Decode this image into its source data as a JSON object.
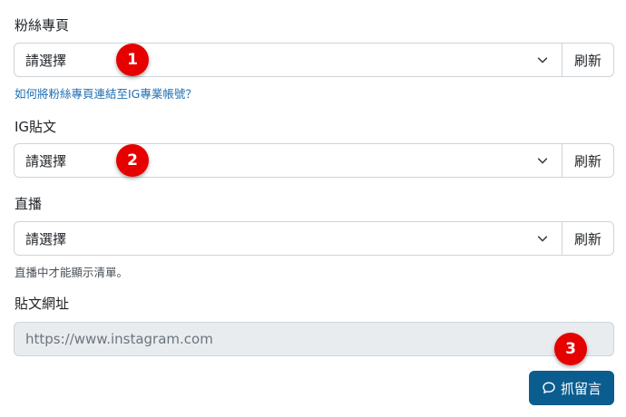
{
  "fan_page": {
    "label": "粉絲專頁",
    "select_value": "請選擇",
    "refresh_label": "刷新",
    "help_link": "如何將粉絲專頁連結至IG專業帳號？"
  },
  "ig_post": {
    "label": "IG貼文",
    "select_value": "請選擇",
    "refresh_label": "刷新"
  },
  "live": {
    "label": "直播",
    "select_value": "請選擇",
    "refresh_label": "刷新",
    "help_text": "直播中才能顯示清單。"
  },
  "post_url": {
    "label": "貼文網址",
    "placeholder": "https://www.instagram.com"
  },
  "submit": {
    "label": "抓留言",
    "icon": "chat-bubble-icon"
  },
  "markers": [
    "1",
    "2",
    "3"
  ],
  "colors": {
    "primary_button": "#0b5d8f",
    "marker": "#e60000",
    "link": "#1f6fb2",
    "disabled_input": "#e9ecef"
  }
}
